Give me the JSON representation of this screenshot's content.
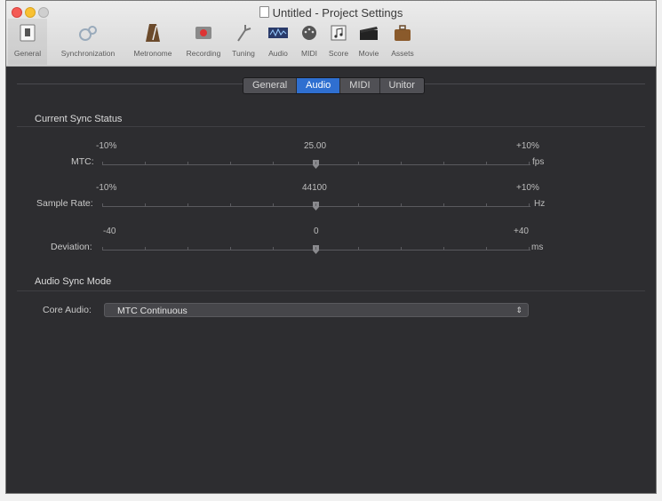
{
  "window": {
    "title": "Untitled - Project Settings"
  },
  "toolbar": {
    "items": [
      {
        "label": "General",
        "icon": "general-icon"
      },
      {
        "label": "Synchronization",
        "icon": "synchronization-icon"
      },
      {
        "label": "Metronome",
        "icon": "metronome-icon"
      },
      {
        "label": "Recording",
        "icon": "recording-icon"
      },
      {
        "label": "Tuning",
        "icon": "tuning-icon"
      },
      {
        "label": "Audio",
        "icon": "audio-icon"
      },
      {
        "label": "MIDI",
        "icon": "midi-icon"
      },
      {
        "label": "Score",
        "icon": "score-icon"
      },
      {
        "label": "Movie",
        "icon": "movie-icon"
      },
      {
        "label": "Assets",
        "icon": "assets-icon"
      }
    ]
  },
  "tabs": [
    "General",
    "Audio",
    "MIDI",
    "Unitor"
  ],
  "active_tab": "Audio",
  "sync_status": {
    "title": "Current Sync Status",
    "rows": [
      {
        "label": "MTC:",
        "min": "-10%",
        "value": "25.00",
        "max": "+10%",
        "unit": "fps",
        "position": 0.0
      },
      {
        "label": "Sample Rate:",
        "min": "-10%",
        "value": "44100",
        "max": "+10%",
        "unit": "Hz",
        "position": 0.0
      },
      {
        "label": "Deviation:",
        "min": "-40",
        "value": "0",
        "max": "+40",
        "unit": "ms",
        "position": 0.0
      }
    ]
  },
  "audio_sync": {
    "title": "Audio Sync Mode",
    "core_audio_label": "Core Audio:",
    "core_audio_value": "MTC Continuous"
  },
  "colors": {
    "tab_active": "#2f6fd0",
    "panel_bg": "#2d2d30"
  }
}
